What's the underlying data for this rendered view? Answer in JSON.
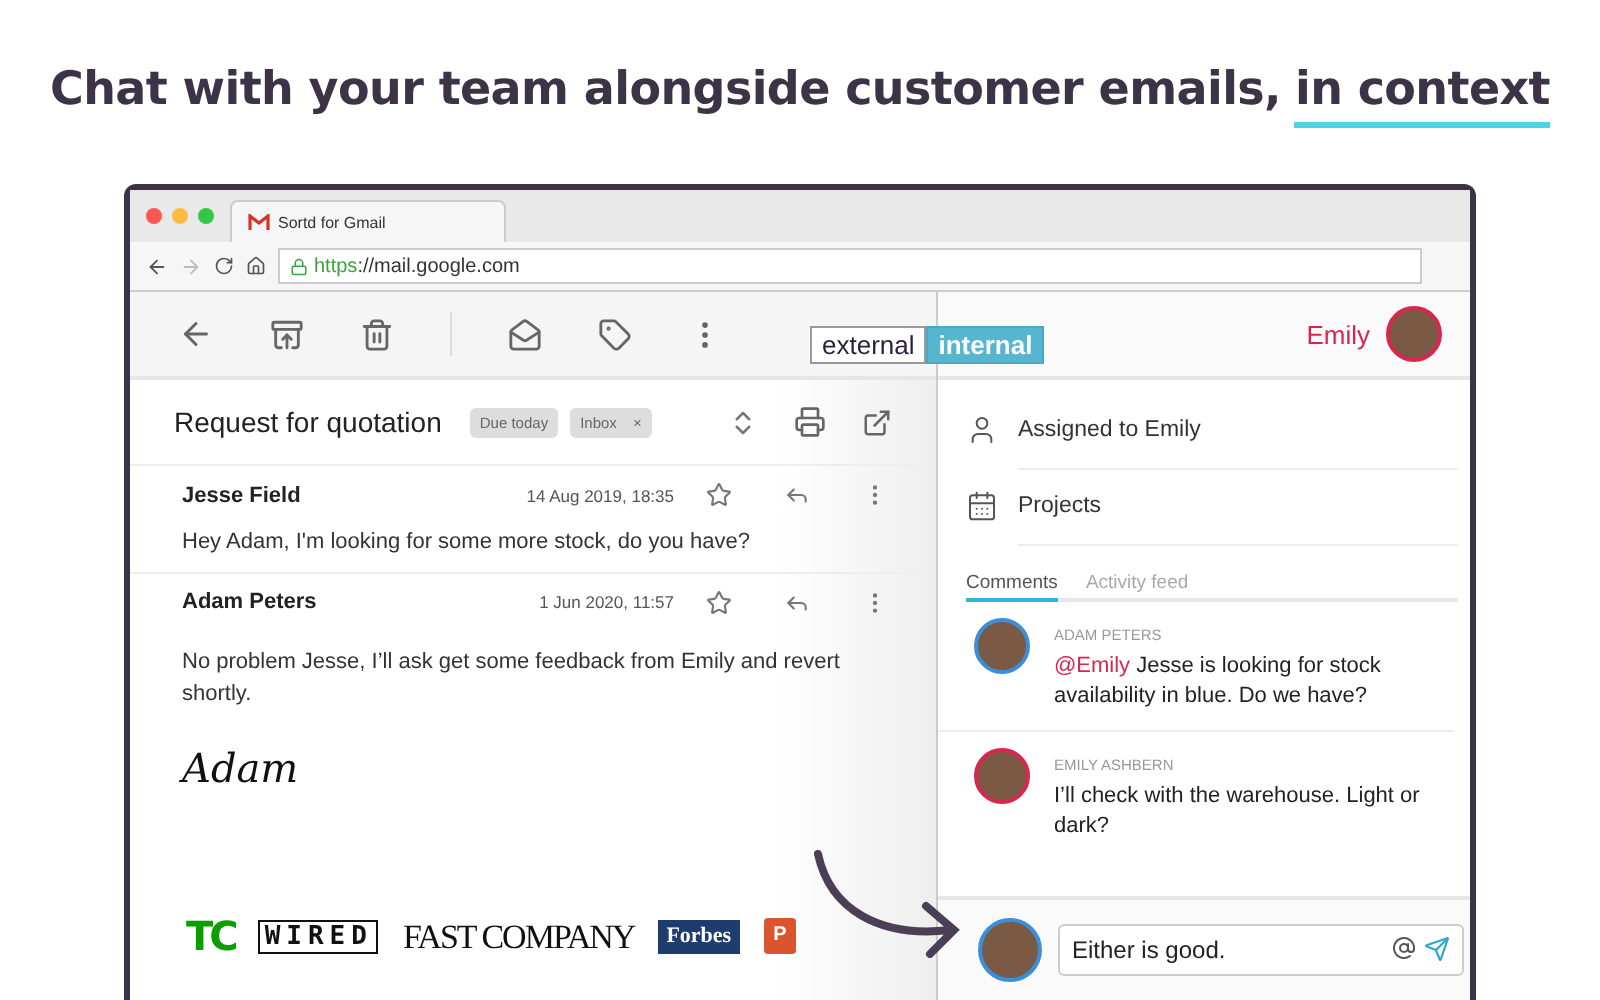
{
  "headline": {
    "text": "Chat with your team alongside customer emails,",
    "highlight": "in context"
  },
  "browser": {
    "tab_title": "Sortd for Gmail",
    "url_scheme": "https",
    "url_rest": "://mail.google.com"
  },
  "mode_tabs": [
    {
      "label": "external",
      "selected": false
    },
    {
      "label": "internal",
      "selected": true
    }
  ],
  "email": {
    "subject": "Request for quotation",
    "labels": [
      {
        "text": "Due today",
        "removable": false
      },
      {
        "text": "Inbox",
        "removable": true
      }
    ],
    "close_mark": "×",
    "messages": [
      {
        "sender": "Jesse Field",
        "date": "14 Aug 2019, 18:35",
        "body": "Hey Adam, I'm looking for some more stock, do you have?"
      },
      {
        "sender": "Adam Peters",
        "date": "1 Jun 2020, 11:57",
        "body": "No problem Jesse, I’ll ask get some feedback from Emily and revert shortly.",
        "signature": "Adam"
      }
    ]
  },
  "press_logos": [
    {
      "kind": "tc",
      "text": "TC"
    },
    {
      "kind": "wired",
      "text": "WIRED"
    },
    {
      "kind": "fastcompany",
      "text": "FAST COMPANY"
    },
    {
      "kind": "forbes",
      "text": "Forbes"
    },
    {
      "kind": "producthunt",
      "text": "P"
    }
  ],
  "panel": {
    "user": "Emily",
    "rows": [
      {
        "kind": "assignee",
        "text": "Assigned to Emily"
      },
      {
        "kind": "projects",
        "text": "Projects"
      }
    ],
    "tabs": [
      {
        "label": "Comments",
        "selected": true
      },
      {
        "label": "Activity feed",
        "selected": false
      }
    ],
    "comments": [
      {
        "author": "ADAM PETERS",
        "color": "#3b8fd9",
        "mention": "@Emily",
        "text": " Jesse is looking for stock availability in blue. Do we have?"
      },
      {
        "author": "EMILY ASHBERN",
        "color": "#d9264f",
        "text": "I’ll check with the warehouse. Light or dark?"
      }
    ],
    "composer": {
      "value": "Either is good."
    }
  }
}
